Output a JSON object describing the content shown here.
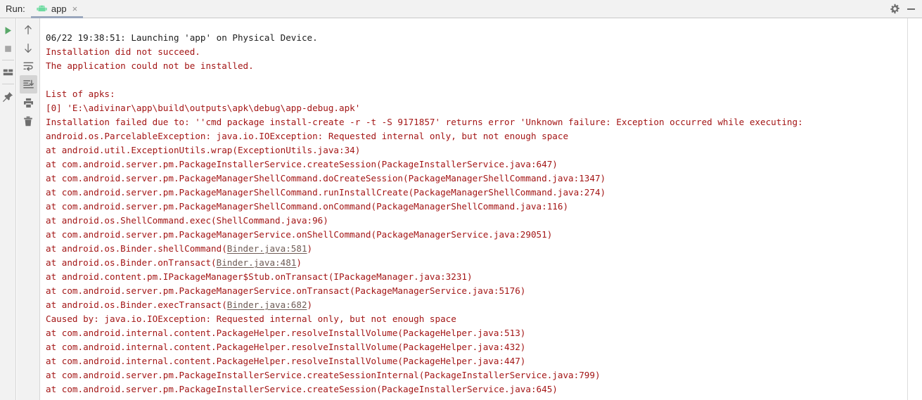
{
  "window": {
    "run_label": "Run:",
    "gear_icon": "gear-icon",
    "minimize_icon": "minimize-icon"
  },
  "tabs": [
    {
      "label": "app",
      "icon": "android-icon",
      "close": "×",
      "selected": true
    }
  ],
  "left_toolbar_primary": [
    {
      "name": "rerun-button",
      "icon": "play-icon",
      "label": "Rerun"
    },
    {
      "name": "stop-button",
      "icon": "stop-icon",
      "label": "Stop"
    },
    {
      "name": "restore-layout-button",
      "icon": "layout-icon",
      "label": "Restore Layout"
    },
    {
      "name": "pin-tab-button",
      "icon": "pin-icon",
      "label": "Pin Tab"
    }
  ],
  "left_toolbar_secondary": [
    {
      "name": "up-the-stack-button",
      "icon": "arrow-up-icon",
      "label": "Up the Stack Trace"
    },
    {
      "name": "down-the-stack-button",
      "icon": "arrow-down-icon",
      "label": "Down the Stack Trace"
    },
    {
      "name": "soft-wrap-button",
      "icon": "soft-wrap-icon",
      "label": "Soft-Wrap",
      "active": false
    },
    {
      "name": "scroll-to-end-button",
      "icon": "scroll-to-end-icon",
      "label": "Scroll to End",
      "active": true
    },
    {
      "name": "print-button",
      "icon": "print-icon",
      "label": "Print"
    },
    {
      "name": "clear-all-button",
      "icon": "trash-icon",
      "label": "Clear All"
    }
  ],
  "console": {
    "lines": [
      {
        "type": "info",
        "text": "06/22 19:38:51: Launching 'app' on Physical Device."
      },
      {
        "type": "error",
        "text": "Installation did not succeed."
      },
      {
        "type": "error",
        "text": "The application could not be installed."
      },
      {
        "type": "blank",
        "text": ""
      },
      {
        "type": "error",
        "text": "List of apks:"
      },
      {
        "type": "error",
        "text": "[0] 'E:\\adivinar\\app\\build\\outputs\\apk\\debug\\app-debug.apk'"
      },
      {
        "type": "error",
        "text": "Installation failed due to: ''cmd package install-create -r -t -S 9171857' returns error 'Unknown failure: Exception occurred while executing:"
      },
      {
        "type": "error",
        "text": "android.os.ParcelableException: java.io.IOException: Requested internal only, but not enough space"
      },
      {
        "type": "error",
        "text": "at android.util.ExceptionUtils.wrap(ExceptionUtils.java:34)"
      },
      {
        "type": "error",
        "text": "at com.android.server.pm.PackageInstallerService.createSession(PackageInstallerService.java:647)"
      },
      {
        "type": "error",
        "text": "at com.android.server.pm.PackageManagerShellCommand.doCreateSession(PackageManagerShellCommand.java:1347)"
      },
      {
        "type": "error",
        "text": "at com.android.server.pm.PackageManagerShellCommand.runInstallCreate(PackageManagerShellCommand.java:274)"
      },
      {
        "type": "error",
        "text": "at com.android.server.pm.PackageManagerShellCommand.onCommand(PackageManagerShellCommand.java:116)"
      },
      {
        "type": "error",
        "text": "at android.os.ShellCommand.exec(ShellCommand.java:96)"
      },
      {
        "type": "error",
        "text": "at com.android.server.pm.PackageManagerService.onShellCommand(PackageManagerService.java:29051)"
      },
      {
        "type": "error-link",
        "prefix": "at android.os.Binder.shellCommand(",
        "link": "Binder.java:581",
        "suffix": ")"
      },
      {
        "type": "error-link",
        "prefix": "at android.os.Binder.onTransact(",
        "link": "Binder.java:481",
        "suffix": ")"
      },
      {
        "type": "error",
        "text": "at android.content.pm.IPackageManager$Stub.onTransact(IPackageManager.java:3231)"
      },
      {
        "type": "error",
        "text": "at com.android.server.pm.PackageManagerService.onTransact(PackageManagerService.java:5176)"
      },
      {
        "type": "error-link",
        "prefix": "at android.os.Binder.execTransact(",
        "link": "Binder.java:682",
        "suffix": ")"
      },
      {
        "type": "error",
        "text": "Caused by: java.io.IOException: Requested internal only, but not enough space"
      },
      {
        "type": "error",
        "text": "at com.android.internal.content.PackageHelper.resolveInstallVolume(PackageHelper.java:513)"
      },
      {
        "type": "error",
        "text": "at com.android.internal.content.PackageHelper.resolveInstallVolume(PackageHelper.java:432)"
      },
      {
        "type": "error",
        "text": "at com.android.internal.content.PackageHelper.resolveInstallVolume(PackageHelper.java:447)"
      },
      {
        "type": "error",
        "text": "at com.android.server.pm.PackageInstallerService.createSessionInternal(PackageInstallerService.java:799)"
      },
      {
        "type": "error",
        "text": "at com.android.server.pm.PackageInstallerService.createSession(PackageInstallerService.java:645)"
      }
    ]
  },
  "colors": {
    "error_text": "#a31515",
    "info_text": "#1c1c1c",
    "link_text": "#6e5b55",
    "chrome_bg": "#f2f2f2",
    "console_bg": "#ffffff",
    "tab_underline": "#9aa7bd",
    "android_green": "#6ddaa0"
  }
}
